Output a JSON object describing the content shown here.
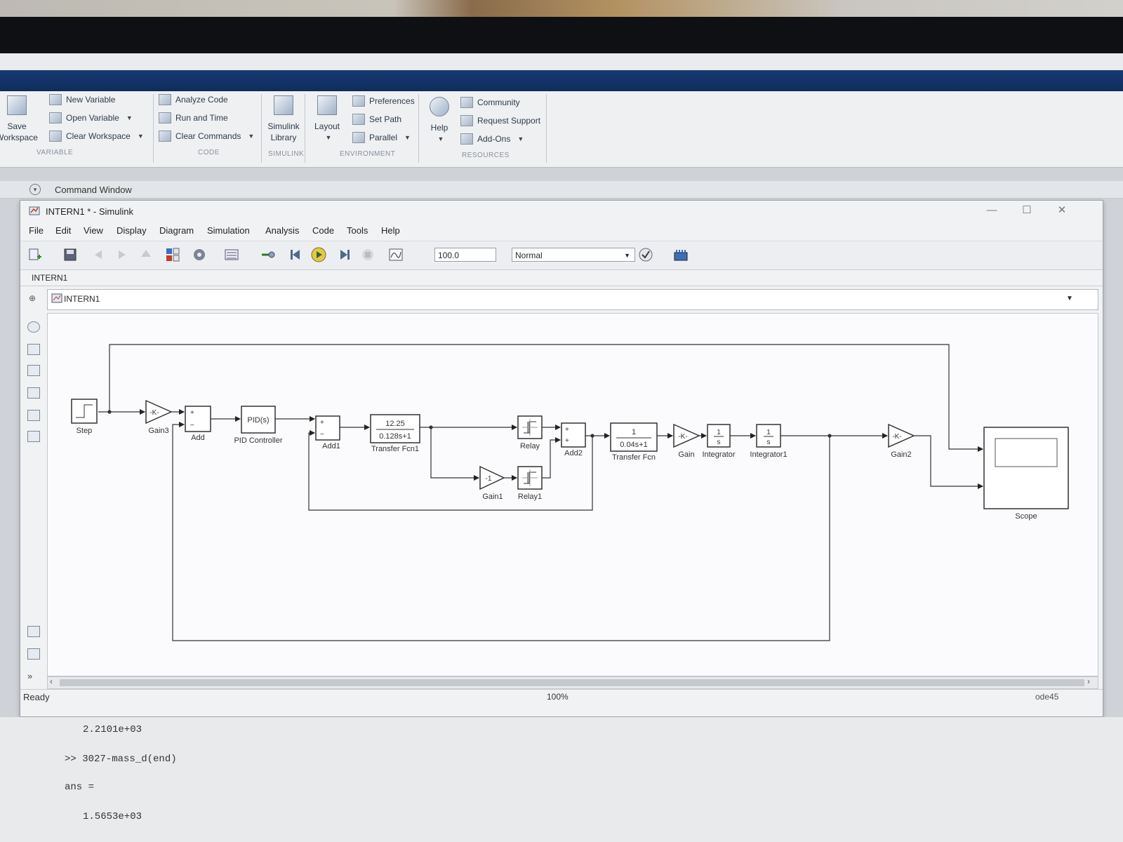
{
  "matlab": {
    "ribbon": {
      "variable": {
        "save_workspace": [
          "Save",
          "Workspace"
        ],
        "new_variable": "New Variable",
        "open_variable": "Open Variable",
        "clear_workspace": "Clear Workspace",
        "group": "VARIABLE"
      },
      "code": {
        "analyze_code": "Analyze Code",
        "run_and_time": "Run and Time",
        "clear_commands": "Clear Commands",
        "group": "CODE"
      },
      "simulink": {
        "library": [
          "Simulink",
          "Library"
        ],
        "group": "SIMULINK"
      },
      "environment": {
        "layout": "Layout",
        "preferences": "Preferences",
        "set_path": "Set Path",
        "parallel": "Parallel",
        "group": "ENVIRONMENT"
      },
      "resources": {
        "help": "Help",
        "community": "Community",
        "request_support": "Request Support",
        "add_ons": "Add-Ons",
        "group": "RESOURCES"
      }
    },
    "command_window_title": "Command Window",
    "command_output": [
      "2.2101e+03",
      ">> 3027-mass_d(end)",
      "ans =",
      "1.5653e+03"
    ]
  },
  "simulink": {
    "title": "INTERN1 * - Simulink",
    "menus": [
      "File",
      "Edit",
      "View",
      "Display",
      "Diagram",
      "Simulation",
      "Analysis",
      "Code",
      "Tools",
      "Help"
    ],
    "stop_time": "100.0",
    "sim_mode": "Normal",
    "model_tab": "INTERN1",
    "breadcrumb": "INTERN1",
    "status": {
      "ready": "Ready",
      "zoom": "100%",
      "solver": "ode45"
    },
    "blocks": {
      "step": "Step",
      "gain3": "Gain3",
      "gain3_value": "-K-",
      "add": "Add",
      "pid": "PID Controller",
      "pid_value": "PID(s)",
      "add1": "Add1",
      "tf1": "Transfer Fcn1",
      "tf1_num": "12.25",
      "tf1_den": "0.128s+1",
      "relay": "Relay",
      "gain1": "Gain1",
      "gain1_value": "-1",
      "relay1": "Relay1",
      "add2": "Add2",
      "tf": "Transfer Fcn",
      "tf_num": "1",
      "tf_den": "0.04s+1",
      "gain": "Gain",
      "gain_value": "-K-",
      "integrator": "Integrator",
      "integrator1": "Integrator1",
      "int_num": "1",
      "int_den": "s",
      "gain2": "Gain2",
      "gain2_value": "-K-",
      "scope": "Scope",
      "plus": "+",
      "minus": "−"
    }
  }
}
